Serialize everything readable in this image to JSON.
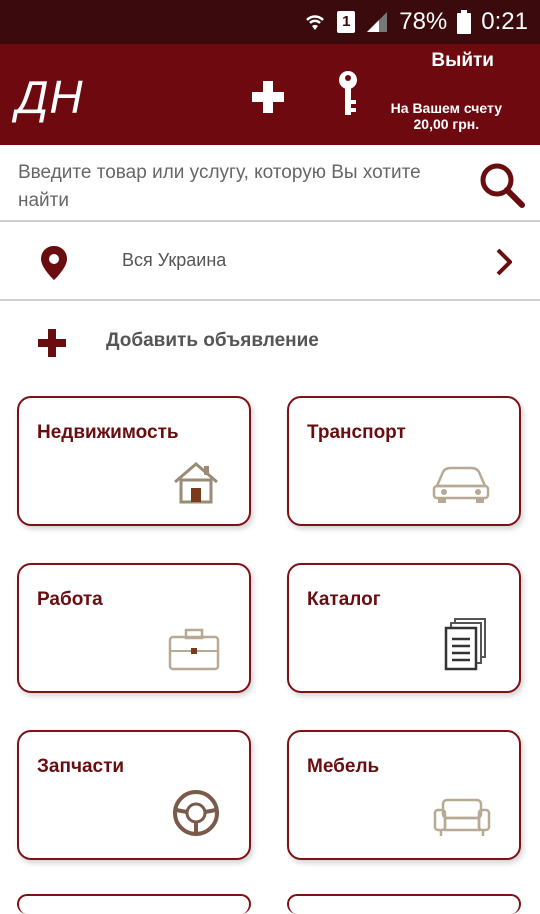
{
  "statusbar": {
    "battery": "78%",
    "time": "0:21",
    "sim": "1"
  },
  "appbar": {
    "logo": "ДН",
    "logout": "Выйти",
    "balance_line1": "На Вашем счету",
    "balance_line2": "20,00 грн."
  },
  "search": {
    "placeholder": "Введите товар или услугу, которую Вы хотите найти"
  },
  "region": {
    "label": "Вся Украина"
  },
  "add_ad": {
    "label": "Добавить объявление"
  },
  "categories": [
    {
      "title": "Недвижимость",
      "icon": "house-icon"
    },
    {
      "title": "Транспорт",
      "icon": "car-icon"
    },
    {
      "title": "Работа",
      "icon": "briefcase-icon"
    },
    {
      "title": "Каталог",
      "icon": "documents-icon"
    },
    {
      "title": "Запчасти",
      "icon": "steering-wheel-icon"
    },
    {
      "title": "Мебель",
      "icon": "sofa-icon"
    }
  ],
  "colors": {
    "brand": "#6e0a0f",
    "statusbar": "#3a0a0c",
    "card_border": "#7d1116",
    "icon": "#9a8b77"
  }
}
